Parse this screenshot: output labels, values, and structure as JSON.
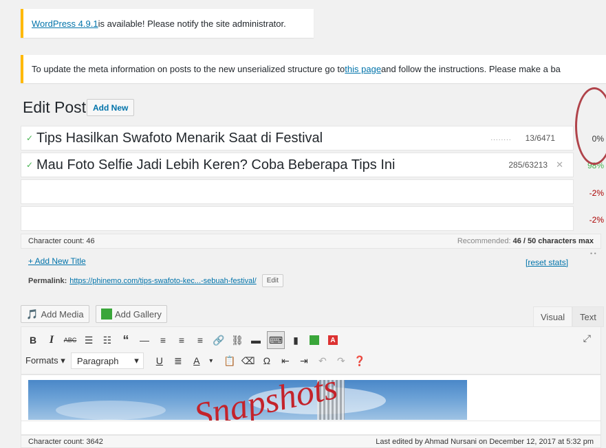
{
  "notices": {
    "update_link": "WordPress 4.9.1",
    "update_rest": " is available! Please notify the site administrator.",
    "meta_pre": "To update the meta information on posts to the new unserialized structure go to ",
    "meta_link": "this page",
    "meta_post": " and follow the instructions. Please make a ba"
  },
  "header": {
    "title": "Edit Post",
    "add_new": "Add New"
  },
  "titles": [
    {
      "text": "Tips Hasilkan Swafoto Menarik Saat di Festival",
      "dots": "........",
      "stat": "13/6471",
      "pct": "0%"
    },
    {
      "text": "Mau Foto Selfie Jadi Lebih Keren? Coba Beberapa Tips Ini",
      "stat": "285/63213",
      "pct": "98%"
    },
    {
      "text": "",
      "pct": "-2%"
    },
    {
      "text": "",
      "pct": "-2%"
    }
  ],
  "char_bar": {
    "count": "Character count: 46",
    "recommended_pre": "Recommended: ",
    "recommended_val": "46 / 50 characters max"
  },
  "links": {
    "add_new_title": "+ Add New Title",
    "reset_stats": "[reset stats]"
  },
  "permalink": {
    "label": "Permalink:",
    "url": "https://phinemo.com/tips-swafoto-kec...-sebuah-festival/",
    "edit": "Edit"
  },
  "media": {
    "add_media": "Add Media",
    "add_gallery": "Add Gallery"
  },
  "tabs": {
    "visual": "Visual",
    "text": "Text"
  },
  "toolbar": {
    "formats": "Formats",
    "paragraph": "Paragraph",
    "bold": "B",
    "italic": "I",
    "strike": "ABC"
  },
  "image": {
    "lettering": "Snapshots"
  },
  "status": {
    "char_count": "Character count: 3642",
    "last_edited": "Last edited by Ahmad Nursani on December 12, 2017 at 5:32 pm"
  },
  "colors": {
    "accent": "#0073aa",
    "notice": "#ffb900",
    "success": "#46b450",
    "error": "#a00",
    "highlight_oval": "#b0434a"
  }
}
